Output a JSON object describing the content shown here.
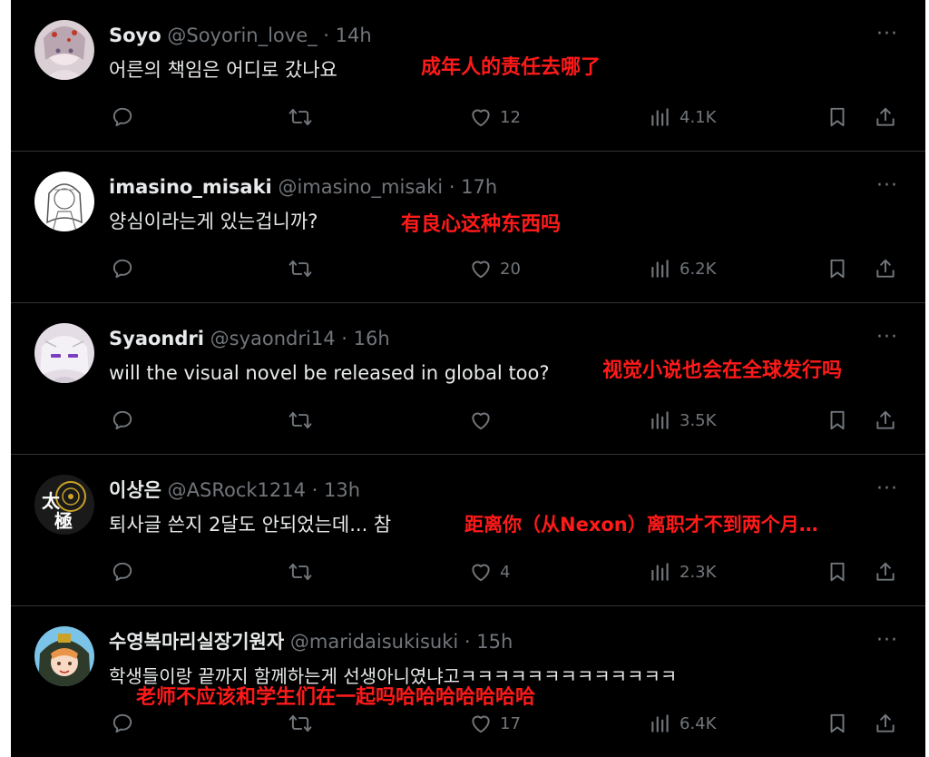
{
  "tweets": [
    {
      "name": "Soyo",
      "handle": "@Soyorin_love_",
      "time": "14h",
      "text": "어른의 책임은 어디로 갔나요",
      "translation": "成年人的责任去哪了",
      "likes": "12",
      "views": "4.1K",
      "avatar": "soyo-avatar"
    },
    {
      "name": "imasino_misaki",
      "handle": "@imasino_misaki",
      "time": "17h",
      "text": "양심이라는게 있는겁니까?",
      "translation": "有良心这种东西吗",
      "likes": "20",
      "views": "6.2K",
      "avatar": "misaki-avatar"
    },
    {
      "name": "Syaondri",
      "handle": "@syaondri14",
      "time": "16h",
      "text": "will the visual novel be released in global too?",
      "translation": "视觉小说也会在全球发行吗",
      "likes": "",
      "views": "3.5K",
      "avatar": "syaondri-avatar"
    },
    {
      "name": "이상은",
      "handle": "@ASRock1214",
      "time": "13h",
      "text": "퇴사글 쓴지 2달도 안되었는데... 참",
      "translation": "距离你（从Nexon）离职才不到两个月…",
      "likes": "4",
      "views": "2.3K",
      "avatar": "taiji-avatar"
    },
    {
      "name": "수영복마리실장기원자",
      "handle": "@maridaisukisuki",
      "time": "15h",
      "text": "학생들이랑 끝까지 함께하는게 선생아니였냐고ㅋㅋㅋㅋㅋㅋㅋㅋㅋㅋㅋㅋㅋ",
      "translation": "老师不应该和学生们在一起吗哈哈哈哈哈哈哈",
      "likes": "17",
      "views": "6.4K",
      "avatar": "mari-avatar"
    }
  ],
  "separator": " · ",
  "more_glyph": "···",
  "colors": {
    "background": "#000000",
    "primary_text": "#e7e9ea",
    "secondary_text": "#71767b",
    "translation_red": "#ff1a1a",
    "divider": "#2f3336"
  }
}
